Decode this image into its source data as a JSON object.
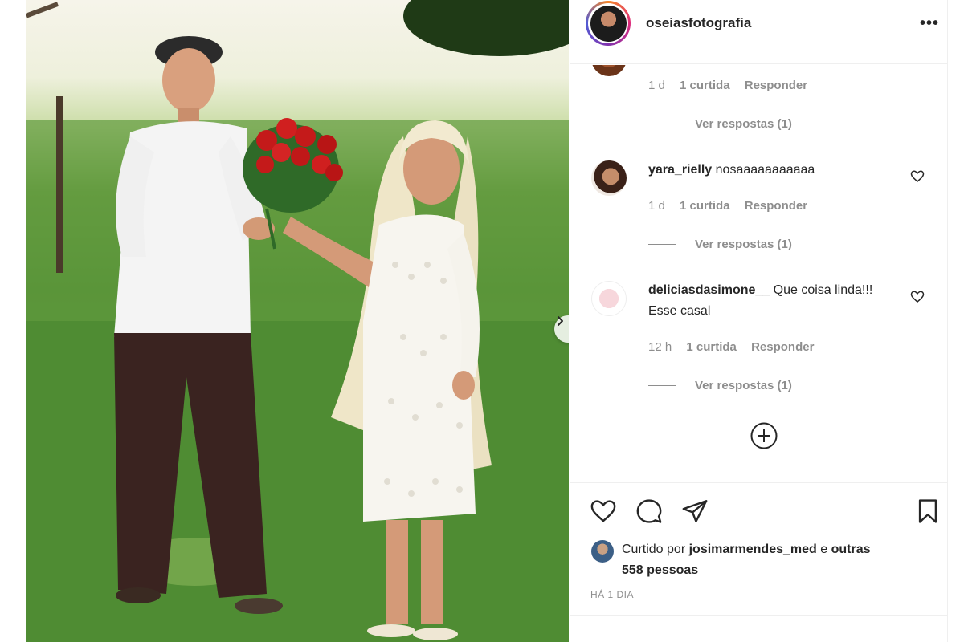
{
  "post": {
    "username": "oseiasfotografia",
    "more_label": "•••",
    "next_arrow": "chevron-right-icon"
  },
  "comments": [
    {
      "username": "",
      "text": "",
      "time": "1 d",
      "likes": "1 curtida",
      "reply": "Responder",
      "view_replies": "Ver respostas (1)"
    },
    {
      "username": "yara_rielly",
      "text": "nosaaaaaaaaaaa",
      "time": "1 d",
      "likes": "1 curtida",
      "reply": "Responder",
      "view_replies": "Ver respostas (1)"
    },
    {
      "username": "deliciasdasimone__",
      "text": "Que coisa linda!!! Esse casal",
      "time": "12 h",
      "likes": "1 curtida",
      "reply": "Responder",
      "view_replies": "Ver respostas (1)"
    }
  ],
  "liked_by": {
    "prefix": "Curtido por",
    "user": "josimarmendes_med",
    "connector": "e",
    "others": "outras 558 pessoas"
  },
  "date": "HÁ 1 DIA",
  "colors": {
    "text": "#262626",
    "muted": "#8e8e8e",
    "border": "#efefef"
  }
}
